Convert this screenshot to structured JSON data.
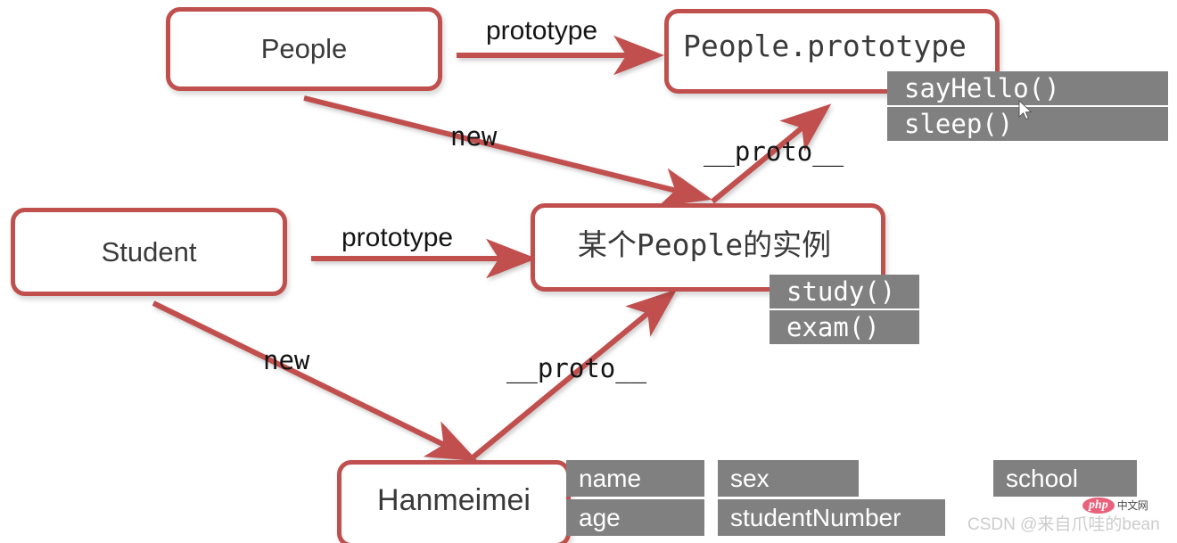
{
  "diagram": {
    "title": "JavaScript prototype chain diagram",
    "colors": {
      "node_border": "#c0504d",
      "arrow": "#c0504d",
      "member_bar": "#808080",
      "member_text": "#ffffff",
      "node_text": "#3a3a3a",
      "background": "#ffffff"
    },
    "nodes": [
      {
        "id": "people",
        "label": "People",
        "font": "sans"
      },
      {
        "id": "people-prototype",
        "label": "People.prototype",
        "font": "mono"
      },
      {
        "id": "student",
        "label": "Student",
        "font": "sans"
      },
      {
        "id": "people-instance",
        "label": "某个People的实例",
        "font": "mono"
      },
      {
        "id": "hanmeimei",
        "label": "Hanmeimei",
        "font": "sans"
      }
    ],
    "members": {
      "people_prototype": [
        {
          "label": "sayHello()",
          "font": "mono"
        },
        {
          "label": "sleep()",
          "font": "mono"
        }
      ],
      "people_instance": [
        {
          "label": "study()",
          "font": "mono"
        },
        {
          "label": "exam()",
          "font": "mono"
        }
      ],
      "hanmeimei": [
        {
          "label": "name",
          "font": "sans"
        },
        {
          "label": "age",
          "font": "sans"
        },
        {
          "label": "sex",
          "font": "sans"
        },
        {
          "label": "studentNumber",
          "font": "sans"
        },
        {
          "label": "school",
          "font": "sans"
        }
      ]
    },
    "edges": [
      {
        "id": "people-to-prototype",
        "label": "prototype",
        "font": "sans",
        "from": "people",
        "to": "people-prototype"
      },
      {
        "id": "people-to-instance",
        "label": "new",
        "font": "mono",
        "from": "people",
        "to": "people-instance"
      },
      {
        "id": "instance-to-prototype",
        "label": "__proto__",
        "font": "mono",
        "from": "people-instance",
        "to": "people-prototype"
      },
      {
        "id": "student-to-instance",
        "label": "prototype",
        "font": "sans",
        "from": "student",
        "to": "people-instance"
      },
      {
        "id": "student-to-hanmeimei",
        "label": "new",
        "font": "mono",
        "from": "student",
        "to": "hanmeimei"
      },
      {
        "id": "hanmeimei-to-instance",
        "label": "__proto__",
        "font": "mono",
        "from": "hanmeimei",
        "to": "people-instance"
      }
    ],
    "watermark": {
      "text": "CSDN @来自爪哇的bean",
      "logo_badge": "php",
      "logo_text": "中文网"
    }
  }
}
